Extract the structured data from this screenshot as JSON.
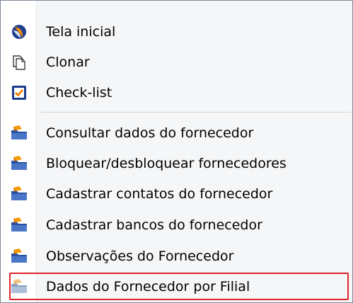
{
  "menu": {
    "items": [
      {
        "label": "Tela inicial",
        "icon": "home-swirl-icon"
      },
      {
        "label": "Clonar",
        "icon": "copy-document-icon"
      },
      {
        "label": "Check-list",
        "icon": "checkbox-icon"
      },
      {
        "label": "Consultar dados do fornecedor",
        "icon": "folder-action-icon"
      },
      {
        "label": "Bloquear/desbloquear fornecedores",
        "icon": "folder-action-icon"
      },
      {
        "label": "Cadastrar contatos do fornecedor",
        "icon": "folder-action-icon"
      },
      {
        "label": "Cadastrar bancos do fornecedor",
        "icon": "folder-action-icon"
      },
      {
        "label": "Observações do Fornecedor",
        "icon": "folder-action-icon"
      },
      {
        "label": "Dados do Fornecedor por Filial",
        "icon": "folder-action-disabled-icon"
      }
    ],
    "highlight_color": "#e0232b",
    "accent_color": "#f08a00"
  }
}
